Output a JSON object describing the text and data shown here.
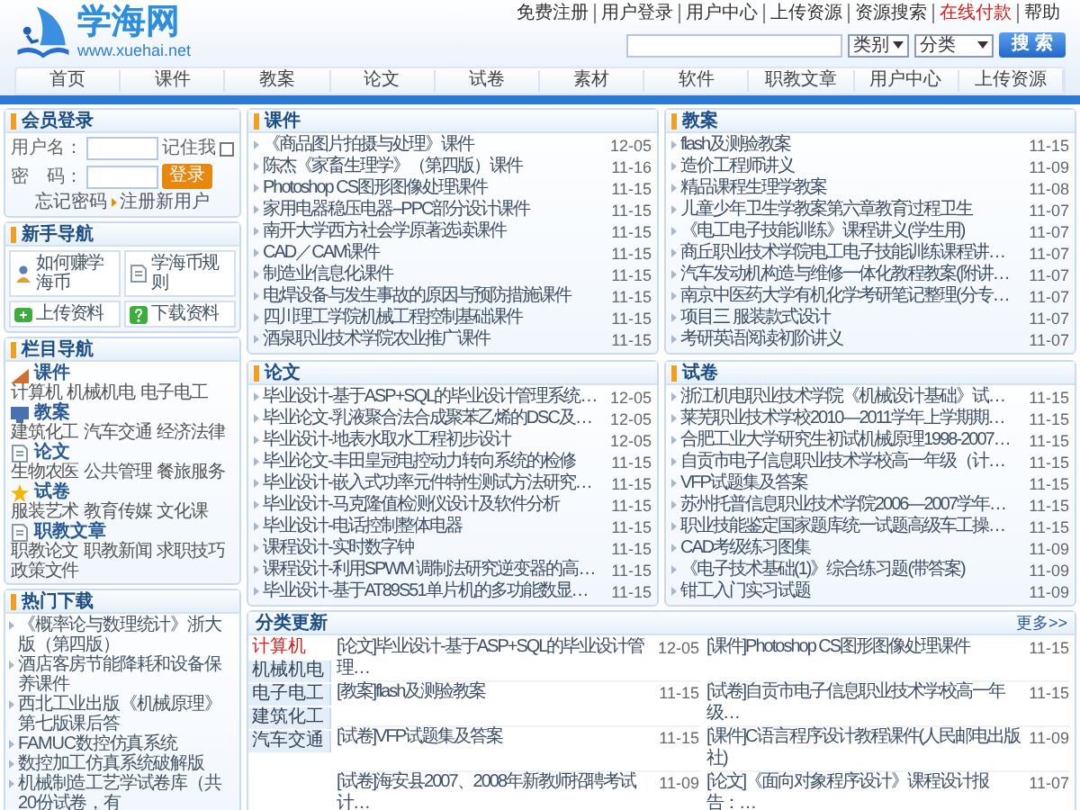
{
  "header": {
    "logo_text": "学海网",
    "logo_url": "www.xuehai.net",
    "top_links": [
      {
        "label": "免费注册",
        "highlight": false
      },
      {
        "label": "用户登录",
        "highlight": false
      },
      {
        "label": "用户中心",
        "highlight": false
      },
      {
        "label": "上传资源",
        "highlight": false
      },
      {
        "label": "资源搜索",
        "highlight": false
      },
      {
        "label": "在线付款",
        "highlight": true
      },
      {
        "label": "帮助",
        "highlight": false
      }
    ],
    "search": {
      "category_select": "类别",
      "class_select": "分类",
      "button": "搜 索"
    }
  },
  "nav": [
    "首页",
    "课件",
    "教案",
    "论文",
    "试卷",
    "素材",
    "软件",
    "职教文章",
    "用户中心",
    "上传资源"
  ],
  "login": {
    "title": "会员登录",
    "username_label": "用户名：",
    "remember_label": "记住我",
    "remember_checked": false,
    "password_label": "密　码：",
    "login_button": "登录",
    "forgot_link": "忘记密码",
    "register_link": "注册新用户"
  },
  "guide": {
    "title": "新手导航",
    "items": [
      {
        "label": "如何赚学海币",
        "kind": "user"
      },
      {
        "label": "学海币规则",
        "kind": "doc"
      },
      {
        "label": "上传资料",
        "kind": "upload"
      },
      {
        "label": "下载资料",
        "kind": "help"
      }
    ]
  },
  "columns_nav": {
    "title": "栏目导航",
    "sections": [
      {
        "name": "课件",
        "kind": "chart",
        "links": [
          "计算机",
          "机械机电",
          "电子电工"
        ]
      },
      {
        "name": "教案",
        "kind": "monitor",
        "links": [
          "建筑化工",
          "汽车交通",
          "经济法律"
        ]
      },
      {
        "name": "论文",
        "kind": "doc",
        "links": [
          "生物农医",
          "公共管理",
          "餐旅服务"
        ]
      },
      {
        "name": "试卷",
        "kind": "star",
        "links": [
          "服装艺术",
          "教育传媒",
          "文化课"
        ]
      },
      {
        "name": "职教文章",
        "kind": "doc",
        "links": [
          "职教论文",
          "职教新闻",
          "求职技巧",
          "政策文件"
        ]
      }
    ]
  },
  "hot": {
    "title": "热门下载",
    "items": [
      "《概率论与数理统计》浙大版（第四版）",
      "酒店客房节能降耗和设备保养课件",
      "西北工业出版《机械原理》第七版课后答",
      "FAMUC数控仿真系统",
      "数控加工仿真系统破解版",
      "机械制造工艺学试卷库（共20份试卷，有"
    ]
  },
  "panels": [
    {
      "title": "课件",
      "items": [
        {
          "title": "《商品图片拍摄与处理》课件",
          "date": "12-05"
        },
        {
          "title": "陈杰《家畜生理学》（第四版）课件",
          "date": "11-16"
        },
        {
          "title": "Photoshop CS图形图像处理课件",
          "date": "11-15"
        },
        {
          "title": "家用电器稳压电器--PPC部分设计课件",
          "date": "11-15"
        },
        {
          "title": "南开大学西方社会学原著选读课件",
          "date": "11-15"
        },
        {
          "title": "CAD／CAM课件",
          "date": "11-15"
        },
        {
          "title": "制造业信息化课件",
          "date": "11-15"
        },
        {
          "title": "电焊设备与发生事故的原因与预防措施课件",
          "date": "11-15"
        },
        {
          "title": "四川理工学院机械工程控制基础课件",
          "date": "11-15"
        },
        {
          "title": "酒泉职业技术学院农业推广课件",
          "date": "11-15"
        }
      ]
    },
    {
      "title": "教案",
      "items": [
        {
          "title": "flash及测验教案",
          "date": "11-15"
        },
        {
          "title": "造价工程师讲义",
          "date": "11-09"
        },
        {
          "title": "精品课程生理学教案",
          "date": "11-08"
        },
        {
          "title": "儿童少年卫生学教案第六章教育过程卫生",
          "date": "11-07"
        },
        {
          "title": "《电工电子技能训练》课程讲义(学生用)",
          "date": "11-07"
        },
        {
          "title": "商丘职业技术学院电工电子技能训练课程讲…",
          "date": "11-07"
        },
        {
          "title": "汽车发动机构造与维修一体化教程教案(附讲…",
          "date": "11-07"
        },
        {
          "title": "南京中医药大学有机化学考研笔记整理(分专…",
          "date": "11-07"
        },
        {
          "title": "项目三 服装款式设计",
          "date": "11-07"
        },
        {
          "title": "考研英语阅读初阶讲义",
          "date": "11-07"
        }
      ]
    },
    {
      "title": "论文",
      "items": [
        {
          "title": "毕业设计-基于ASP+SQL的毕业设计管理系统…",
          "date": "12-05"
        },
        {
          "title": "毕业论文-乳液聚合法合成聚苯乙烯的DSC及…",
          "date": "12-05"
        },
        {
          "title": "毕业设计-地表水取水工程初步设计",
          "date": "12-05"
        },
        {
          "title": "毕业论文-丰田皇冠电控动力转向系统的检修",
          "date": "11-15"
        },
        {
          "title": "毕业设计-嵌入式功率元件特性测试方法研究…",
          "date": "11-15"
        },
        {
          "title": "毕业设计-马克隆值检测仪设计及软件分析",
          "date": "11-15"
        },
        {
          "title": "毕业设计-电话控制整体电器",
          "date": "11-15"
        },
        {
          "title": "课程设计-实时数字钟",
          "date": "11-15"
        },
        {
          "title": "课程设计-利用SPWM 调制法研究逆变器的高…",
          "date": "11-15"
        },
        {
          "title": "毕业设计-基于AT89S51单片机的多功能数显…",
          "date": "11-15"
        }
      ]
    },
    {
      "title": "试卷",
      "items": [
        {
          "title": "浙江机电职业技术学院《机械设计基础》试…",
          "date": "11-15"
        },
        {
          "title": "莱芜职业技术学校2010—2011学年上学期期…",
          "date": "11-15"
        },
        {
          "title": "合肥工业大学研究生初试机械原理1998-2007…",
          "date": "11-15"
        },
        {
          "title": "自贡市电子信息职业技术学校高一年级（计…",
          "date": "11-15"
        },
        {
          "title": "VFP试题集及答案",
          "date": "11-15"
        },
        {
          "title": "苏州托普信息职业技术学院2006—2007学年…",
          "date": "11-15"
        },
        {
          "title": "职业技能鉴定国家题库统一试题高级车工操…",
          "date": "11-15"
        },
        {
          "title": "CAD考级练习图集",
          "date": "11-09"
        },
        {
          "title": "《电子技术基础(1)》综合练习题(带答案)",
          "date": "11-09"
        },
        {
          "title": "钳工入门实习试题",
          "date": "11-09"
        }
      ]
    }
  ],
  "updates": {
    "title": "分类更新",
    "more": "更多>>",
    "tabs": [
      {
        "label": "计算机",
        "selected": true
      },
      {
        "label": "机械机电",
        "selected": false
      },
      {
        "label": "电子电工",
        "selected": false
      },
      {
        "label": "建筑化工",
        "selected": false
      },
      {
        "label": "汽车交通",
        "selected": false
      }
    ],
    "items": [
      {
        "title": "[论文]毕业设计-基于ASP+SQL的毕业设计管理…",
        "date": "12-05"
      },
      {
        "title": "[课件]Photoshop CS图形图像处理课件",
        "date": "11-15"
      },
      {
        "title": "[教案]flash及测验教案",
        "date": "11-15"
      },
      {
        "title": "[试卷]自贡市电子信息职业技术学校高一年级…",
        "date": "11-15"
      },
      {
        "title": "[试卷]VFP试题集及答案",
        "date": "11-15"
      },
      {
        "title": "[课件]C语言程序设计教程课件(人民邮电出版社)",
        "date": "11-09"
      },
      {
        "title": "[试卷]海安县2007、2008年新教师招聘考试计…",
        "date": "11-09"
      },
      {
        "title": "[论文]《面向对象程序设计》课程设计报告：…",
        "date": "11-07"
      }
    ]
  }
}
